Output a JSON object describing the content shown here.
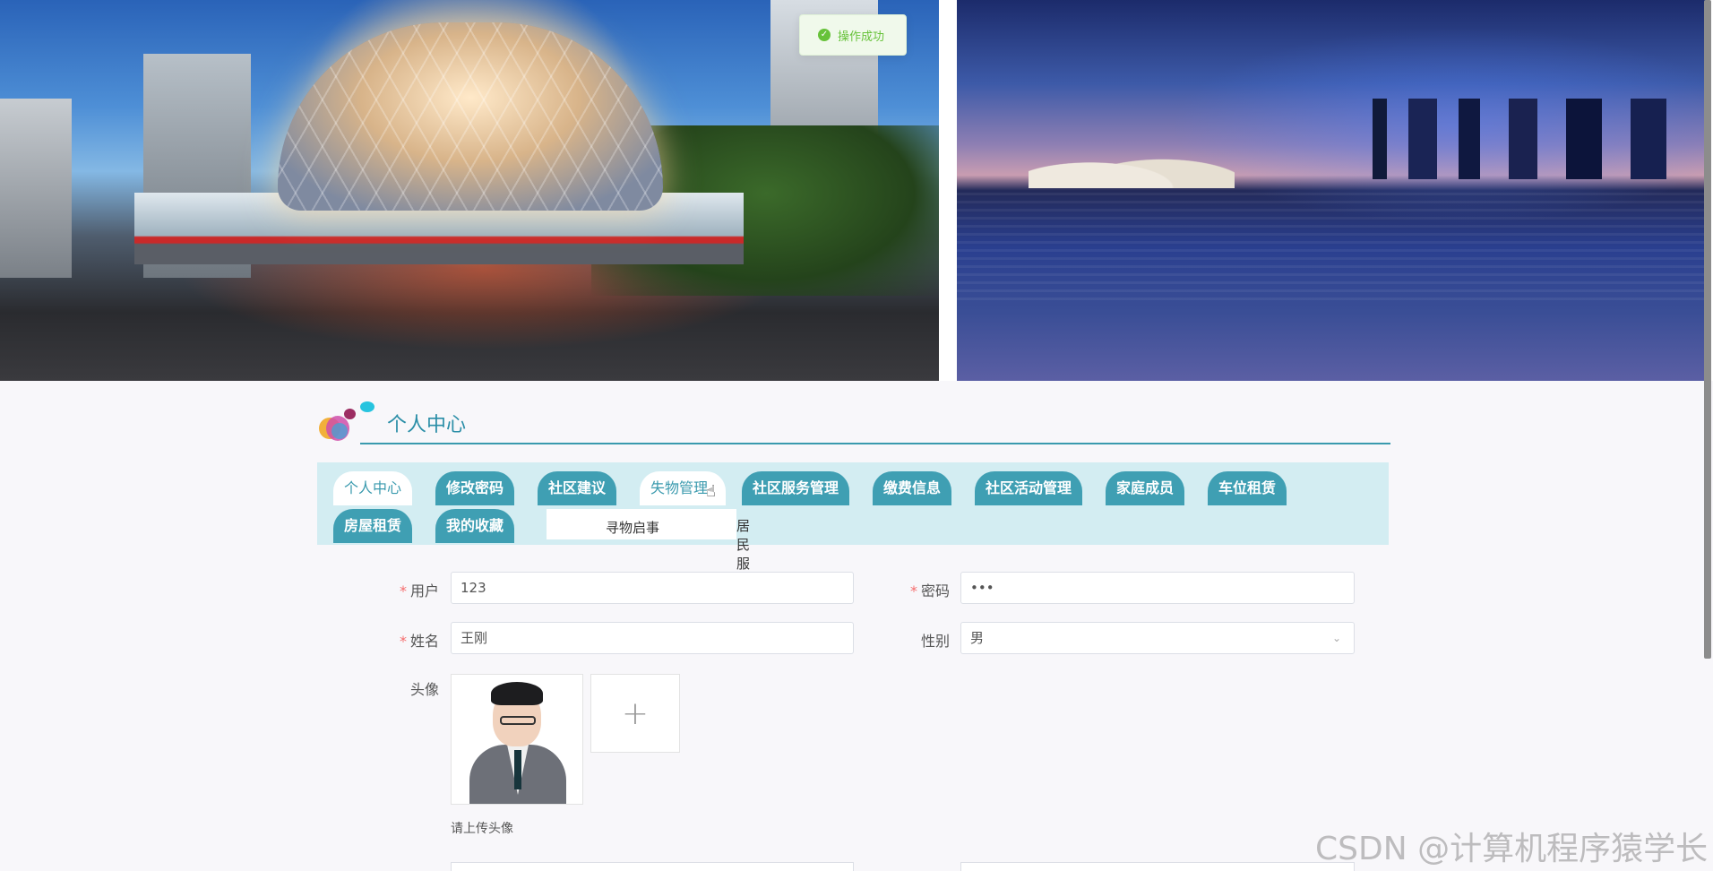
{
  "toast": {
    "message": "操作成功"
  },
  "section": {
    "title": "个人中心"
  },
  "tabs": [
    {
      "label": "个人中心",
      "active": true
    },
    {
      "label": "修改密码"
    },
    {
      "label": "社区建议"
    },
    {
      "label": "失物管理"
    },
    {
      "label": "社区服务管理"
    },
    {
      "label": "缴费信息"
    },
    {
      "label": "社区活动管理"
    },
    {
      "label": "家庭成员"
    },
    {
      "label": "车位租赁"
    },
    {
      "label": "房屋租赁"
    },
    {
      "label": "我的收藏"
    }
  ],
  "dropdown": {
    "items": [
      "寻物启事",
      "居民服务"
    ]
  },
  "form": {
    "username": {
      "label": "用户",
      "value": "123"
    },
    "password": {
      "label": "密码",
      "value": "•••"
    },
    "name": {
      "label": "姓名",
      "value": "王刚"
    },
    "gender": {
      "label": "性别",
      "value": "男"
    },
    "avatar": {
      "label": "头像",
      "hint": "请上传头像"
    }
  },
  "watermark": "CSDN @计算机程序猿学长",
  "colors": {
    "accent": "#3f9fb3",
    "tab_bar_bg": "#d3edf2",
    "success": "#67c23a",
    "required": "#f56c6c"
  }
}
